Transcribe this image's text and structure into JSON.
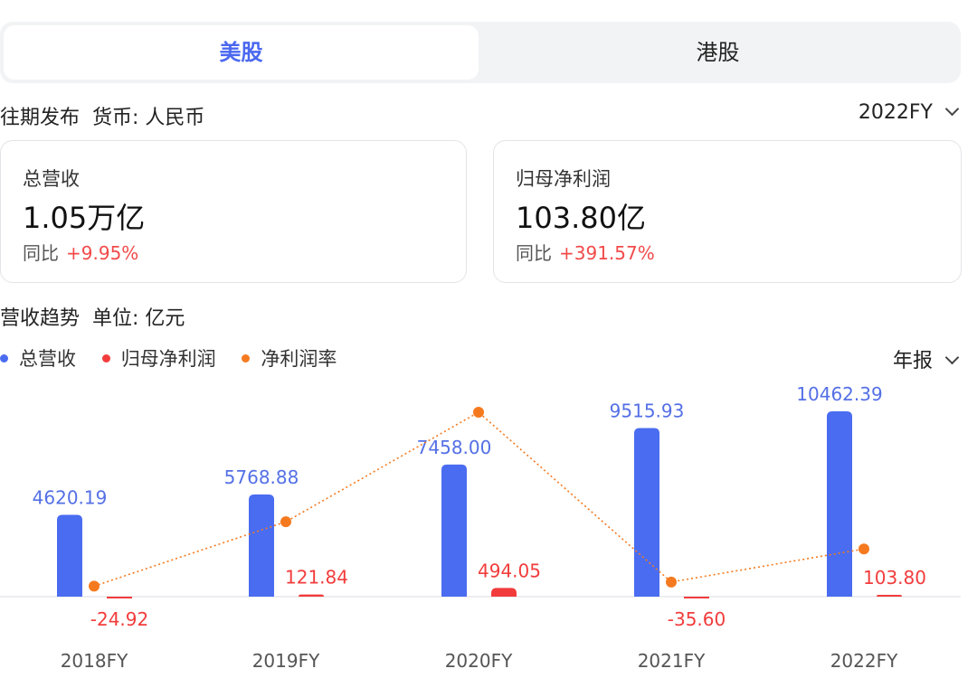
{
  "tabs": [
    {
      "label": "美股",
      "active": true
    },
    {
      "label": "港股",
      "active": false
    }
  ],
  "info": {
    "period_label": "往期发布",
    "currency_label": "货币: 人民币",
    "fiscal_year": "2022FY"
  },
  "cards": [
    {
      "title": "总营收",
      "value": "1.05万亿",
      "yoy_label": "同比",
      "yoy_value": "+9.95%"
    },
    {
      "title": "归母净利润",
      "value": "103.80亿",
      "yoy_label": "同比",
      "yoy_value": "+391.57%"
    }
  ],
  "trend": {
    "title": "营收趋势",
    "unit": "单位: 亿元",
    "period_select": "年报"
  },
  "colors": {
    "revenue": "#4a6cf0",
    "net_profit": "#f23c3c",
    "margin": "#f57a1f",
    "accent": "#4a67f0"
  },
  "chart_data": {
    "type": "bar",
    "categories": [
      "2018FY",
      "2019FY",
      "2020FY",
      "2021FY",
      "2022FY"
    ],
    "series": [
      {
        "name": "总营收",
        "kind": "bar",
        "values": [
          4620.19,
          5768.88,
          7458.0,
          9515.93,
          10462.39
        ],
        "labels": [
          "4620.19",
          "5768.88",
          "7458.00",
          "9515.93",
          "10462.39"
        ]
      },
      {
        "name": "归母净利润",
        "kind": "bar",
        "values": [
          -24.92,
          121.84,
          494.05,
          -35.6,
          103.8
        ],
        "labels": [
          "-24.92",
          "121.84",
          "494.05",
          "-35.60",
          "103.80"
        ]
      },
      {
        "name": "净利润率",
        "kind": "line",
        "values": [
          -0.54,
          2.11,
          6.62,
          -0.37,
          0.99
        ]
      }
    ],
    "legend_position": "top-left",
    "grid": false
  }
}
